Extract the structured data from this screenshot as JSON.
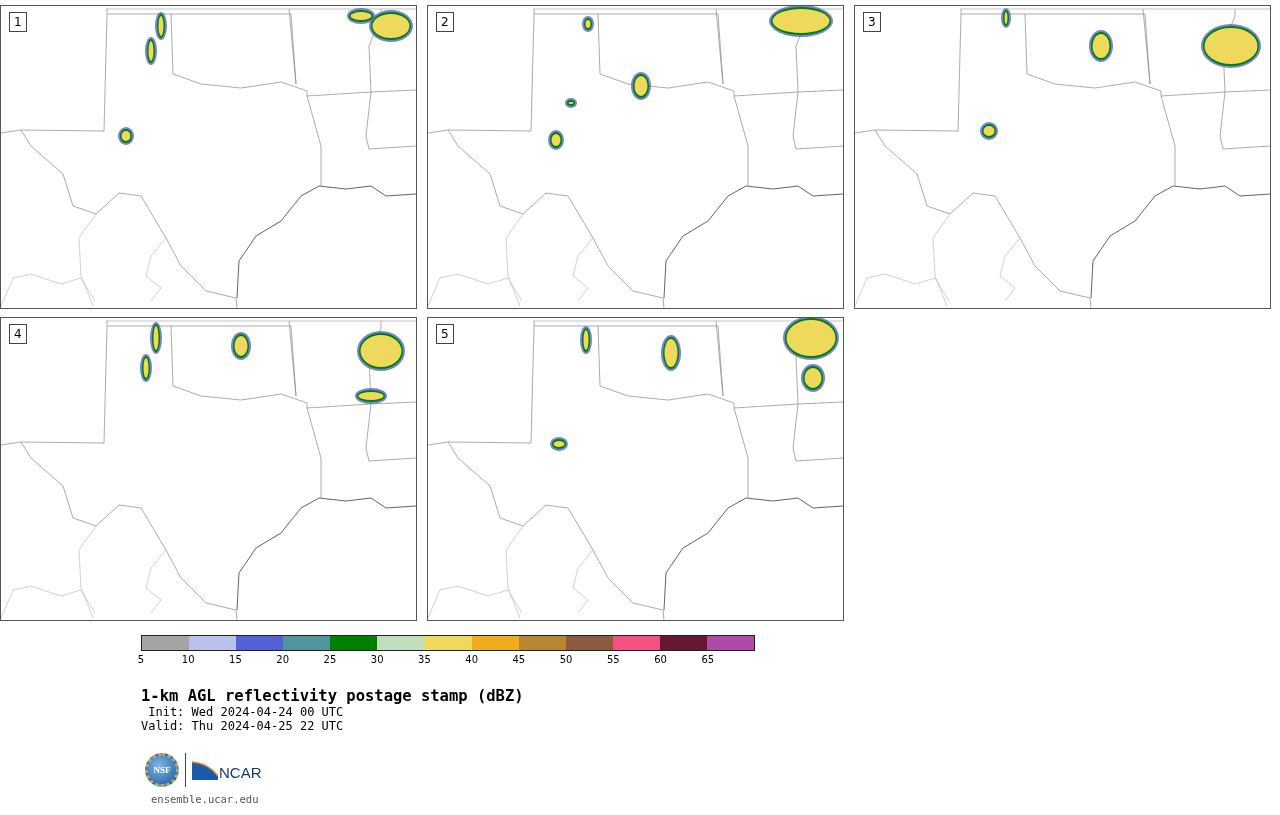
{
  "panels": [
    {
      "number": "1"
    },
    {
      "number": "2"
    },
    {
      "number": "3"
    },
    {
      "number": "4"
    },
    {
      "number": "5"
    }
  ],
  "colorbar": {
    "bins": [
      {
        "tick": "5",
        "color": "#a4a4a4"
      },
      {
        "tick": "10",
        "color": "#b8c2ed"
      },
      {
        "tick": "15",
        "color": "#5462d6"
      },
      {
        "tick": "20",
        "color": "#50969c"
      },
      {
        "tick": "25",
        "color": "#008000"
      },
      {
        "tick": "30",
        "color": "#bfdfbf"
      },
      {
        "tick": "35",
        "color": "#efd95c"
      },
      {
        "tick": "40",
        "color": "#efad1b"
      },
      {
        "tick": "45",
        "color": "#b88530"
      },
      {
        "tick": "50",
        "color": "#8a5b3e"
      },
      {
        "tick": "55",
        "color": "#f45080"
      },
      {
        "tick": "60",
        "color": "#641834"
      },
      {
        "tick": "65",
        "color": "#ad4ca6"
      }
    ]
  },
  "title": "1-km AGL reflectivity postage stamp (dBZ)",
  "init": " Init: Wed 2024-04-24 00 UTC",
  "valid": "Valid: Thu 2024-04-25 22 UTC",
  "logos": {
    "nsf": "NSF",
    "ncar": "NCAR"
  },
  "footer": "ensemble.ucar.edu"
}
